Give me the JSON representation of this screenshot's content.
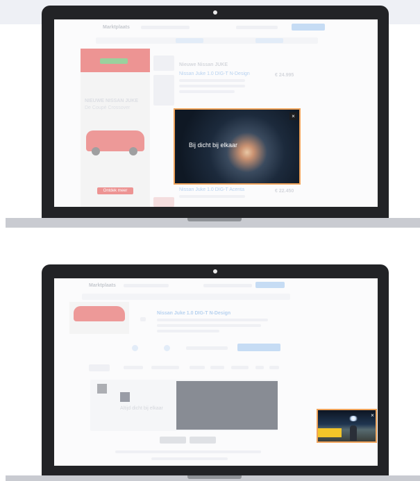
{
  "site": {
    "logo": "Marktplaats"
  },
  "upper_screen": {
    "listing_heading": "Nieuwe Nissan JUKE",
    "listing_title_1": "Nissan Juke 1.0 DIG-T N-Design",
    "listing_price_1": "€ 24.995",
    "listing_title_2": "Nissan Juke 1.0 DIG-T Acenta",
    "listing_price_2": "€ 22.450",
    "ad": {
      "headline": "NIEUWE NISSAN JUKE",
      "subline": "De Coupé Crossover",
      "cta": "Ontdek meer"
    },
    "video": {
      "title": "Bij dicht bij elkaar",
      "close": "×"
    }
  },
  "lower_screen": {
    "listing_heading": "Nissan Juke 1.0 DIG-T N-Design",
    "card_text": "Altijd dicht bij elkaar",
    "mini_player_close": "×"
  },
  "colors": {
    "accent_border": "#f0a35a",
    "laptop_frame": "#222326",
    "ad_red": "#e2403f",
    "link_blue": "#9cc3ef"
  }
}
